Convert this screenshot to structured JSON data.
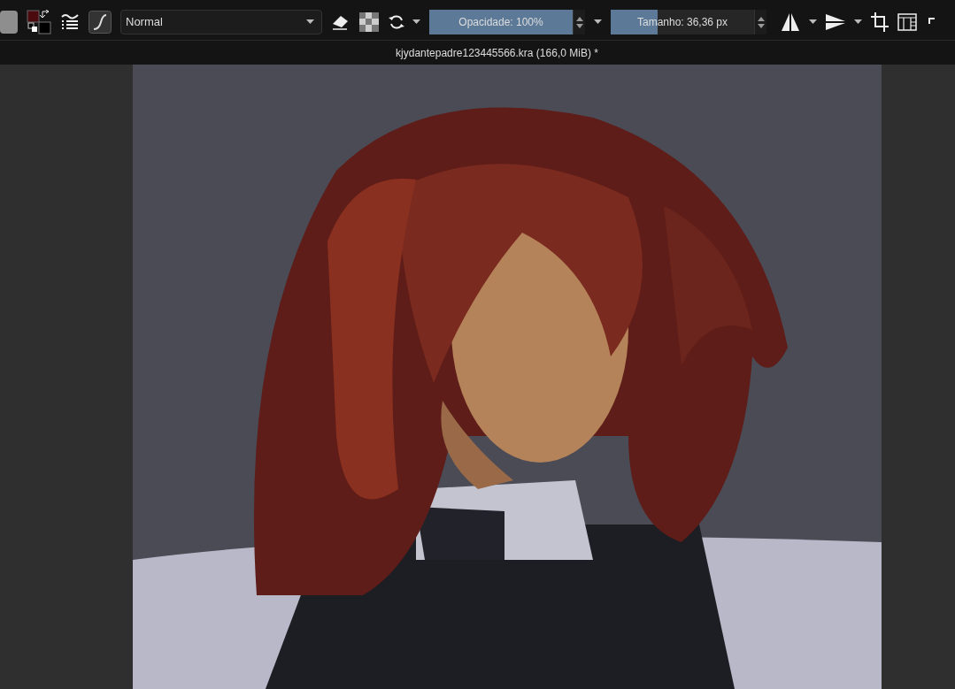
{
  "toolbar": {
    "blend_mode": "Normal",
    "opacity": {
      "label": "Opacidade: 100%",
      "level": 1
    },
    "size": {
      "label": "Tamanho: 36,36 px",
      "level": 0.33
    }
  },
  "document_tab": {
    "title": "kjydantepadre123445566.kra (166,0 MiB) *"
  }
}
